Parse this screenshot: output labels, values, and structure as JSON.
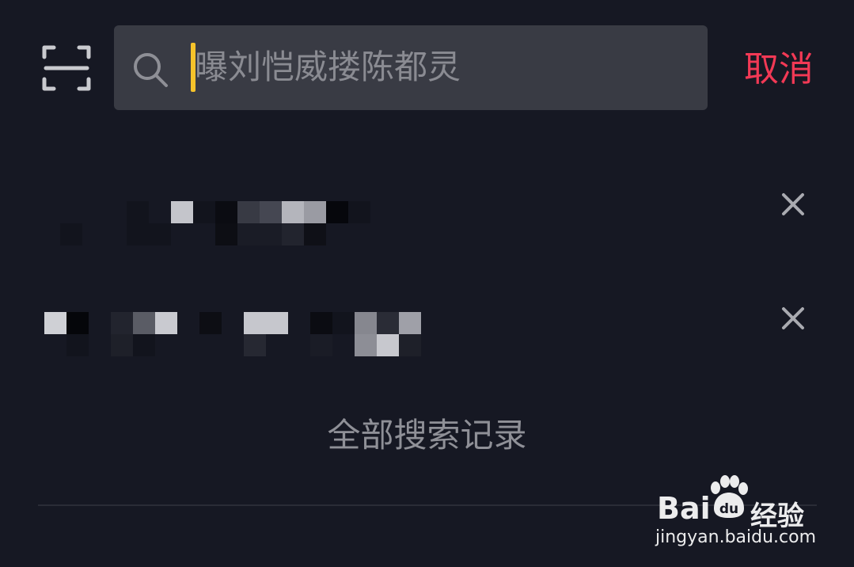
{
  "header": {
    "scan_icon": "scan-frame-icon",
    "search_icon": "search-icon",
    "search": {
      "value": "",
      "placeholder": "曝刘恺威搂陈都灵"
    },
    "cancel_label": "取消",
    "colors": {
      "caret": "#f6c32a",
      "cancel": "#f23955"
    }
  },
  "history": {
    "items": [
      {
        "text": "(",
        "delete_icon": "close-icon"
      },
      {
        "text": "",
        "delete_icon": "close-icon"
      }
    ],
    "show_all_label": "全部搜索记录"
  },
  "watermark": {
    "logo_text": "Bai",
    "logo_suffix_small": "du",
    "suffix": "经验",
    "url": "jingyan.baidu.com"
  }
}
